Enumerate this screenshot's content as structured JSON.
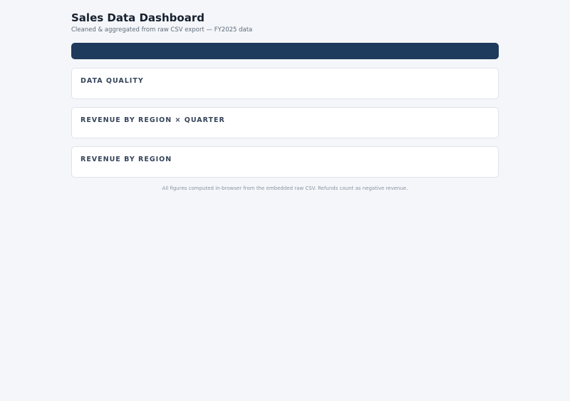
{
  "header": {
    "title": "Sales Data Dashboard",
    "subtitle": "Cleaned & aggregated from raw CSV export — FY2025 data"
  },
  "sections": {
    "data_quality": {
      "title": "DATA QUALITY"
    },
    "region_quarter": {
      "title": "REVENUE BY REGION × QUARTER"
    },
    "by_region": {
      "title": "REVENUE BY REGION"
    }
  },
  "footer": {
    "note": "All figures computed in-browser from the embedded raw CSV. Refunds count as negative revenue."
  },
  "colors": {
    "background": "#f4f6f9",
    "banner": "#1e3a5c",
    "card": "#ffffff"
  }
}
